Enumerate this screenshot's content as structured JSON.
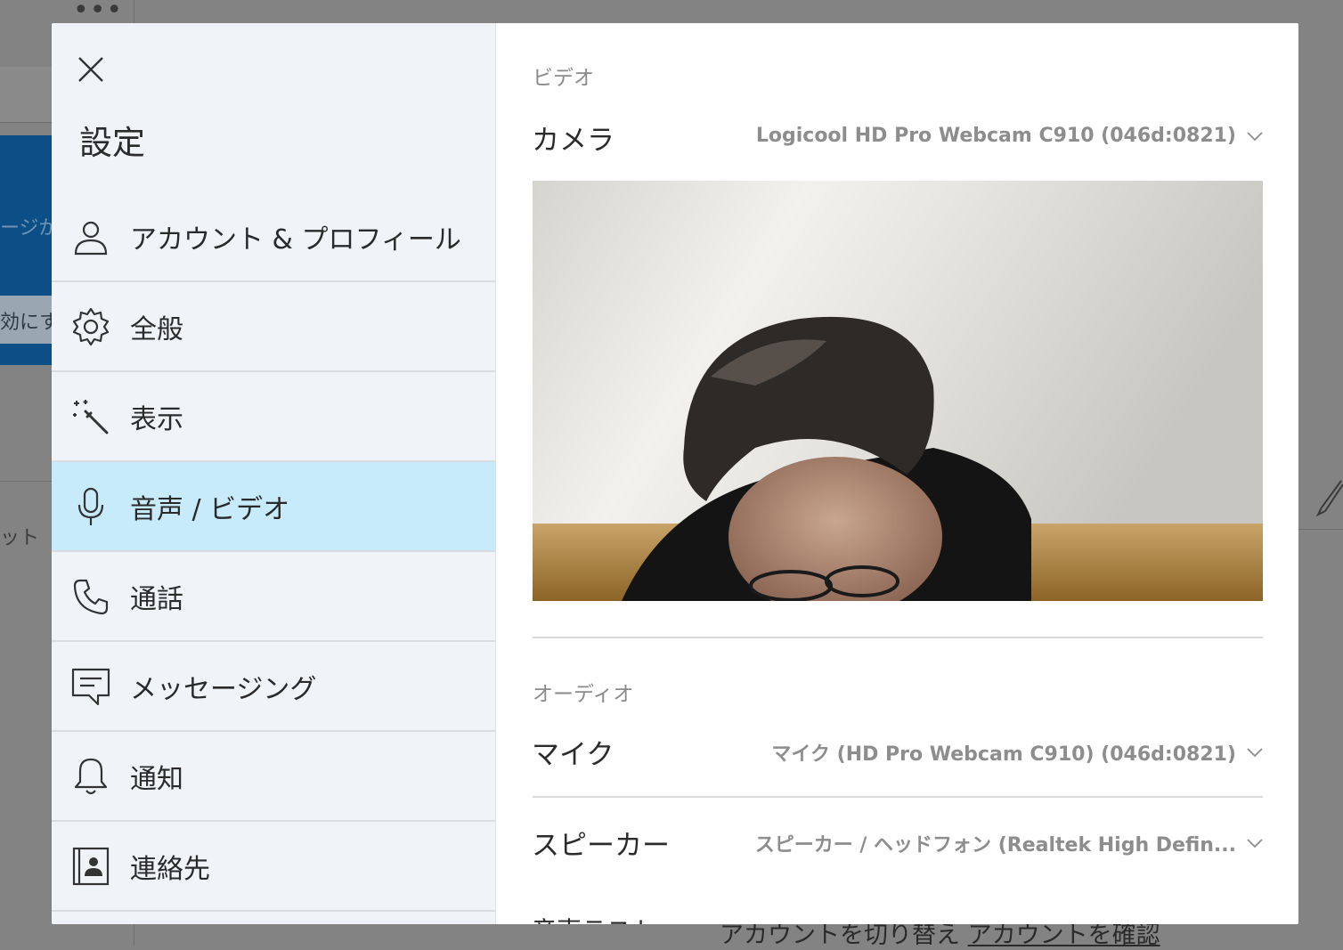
{
  "background": {
    "ellipsis": "•••",
    "blue_text": "ージが",
    "blue_button": "効にす",
    "side_text": "ット",
    "bottom_link_1": "アカウントを切り替え",
    "bottom_link_2": "アカウントを確認"
  },
  "settings": {
    "title": "設定",
    "nav": [
      {
        "label": "アカウント & プロフィール",
        "icon": "person-icon"
      },
      {
        "label": "全般",
        "icon": "gear-icon"
      },
      {
        "label": "表示",
        "icon": "magic-wand-icon"
      },
      {
        "label": "音声 / ビデオ",
        "icon": "microphone-icon",
        "active": true
      },
      {
        "label": "通話",
        "icon": "phone-icon"
      },
      {
        "label": "メッセージング",
        "icon": "message-icon"
      },
      {
        "label": "通知",
        "icon": "bell-icon"
      },
      {
        "label": "連絡先",
        "icon": "contact-card-icon"
      }
    ]
  },
  "content": {
    "video_section": "ビデオ",
    "camera_label": "カメラ",
    "camera_value": "Logicool HD Pro Webcam C910 (046d:0821)",
    "audio_section": "オーディオ",
    "mic_label": "マイク",
    "mic_value": "マイク (HD Pro Webcam C910) (046d:0821)",
    "speaker_label": "スピーカー",
    "speaker_value": "スピーカー / ヘッドフォン (Realtek High Defin...",
    "bottom_cut_text": "音声テスト"
  },
  "colors": {
    "active_nav": "#c7ebfb",
    "sidebar_bg": "#f0f4f9",
    "overlay": "#838383"
  }
}
